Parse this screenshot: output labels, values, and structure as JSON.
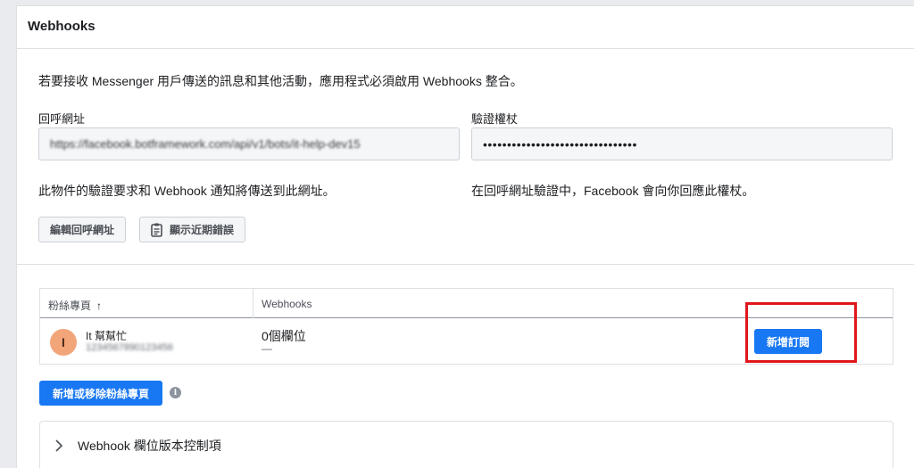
{
  "panel": {
    "title": "Webhooks"
  },
  "intro": "若要接收 Messenger 用戶傳送的訊息和其他活動，應用程式必須啟用 Webhooks 整合。",
  "callback": {
    "label": "回呼網址",
    "value": "https://facebook.botframework.com/api/v1/bots/it-help-dev15",
    "note": "此物件的驗證要求和 Webhook 通知將傳送到此網址。"
  },
  "verify": {
    "label": "驗證權杖",
    "value": "••••••••••••••••••••••••••••••••",
    "note": "在回呼網址驗證中，Facebook 會向你回應此權杖。"
  },
  "buttons": {
    "edit_callback": "編輯回呼網址",
    "show_errors": "顯示近期錯誤",
    "add_subscription": "新增訂閱",
    "add_remove_pages": "新增或移除粉絲專頁"
  },
  "table": {
    "headers": {
      "page": "粉絲專頁",
      "sort_arrow": "↑",
      "webhooks": "Webhooks"
    },
    "rows": [
      {
        "avatar_letter": "I",
        "page_name": "It 幫幫忙",
        "page_id": "1234567890123456",
        "fields": "0個欄位",
        "dash": "—"
      }
    ]
  },
  "accordion": {
    "label": "Webhook 欄位版本控制項"
  },
  "colors": {
    "accent": "#1877f2",
    "highlight": "#e0161b",
    "avatar": "#f3a57a"
  }
}
